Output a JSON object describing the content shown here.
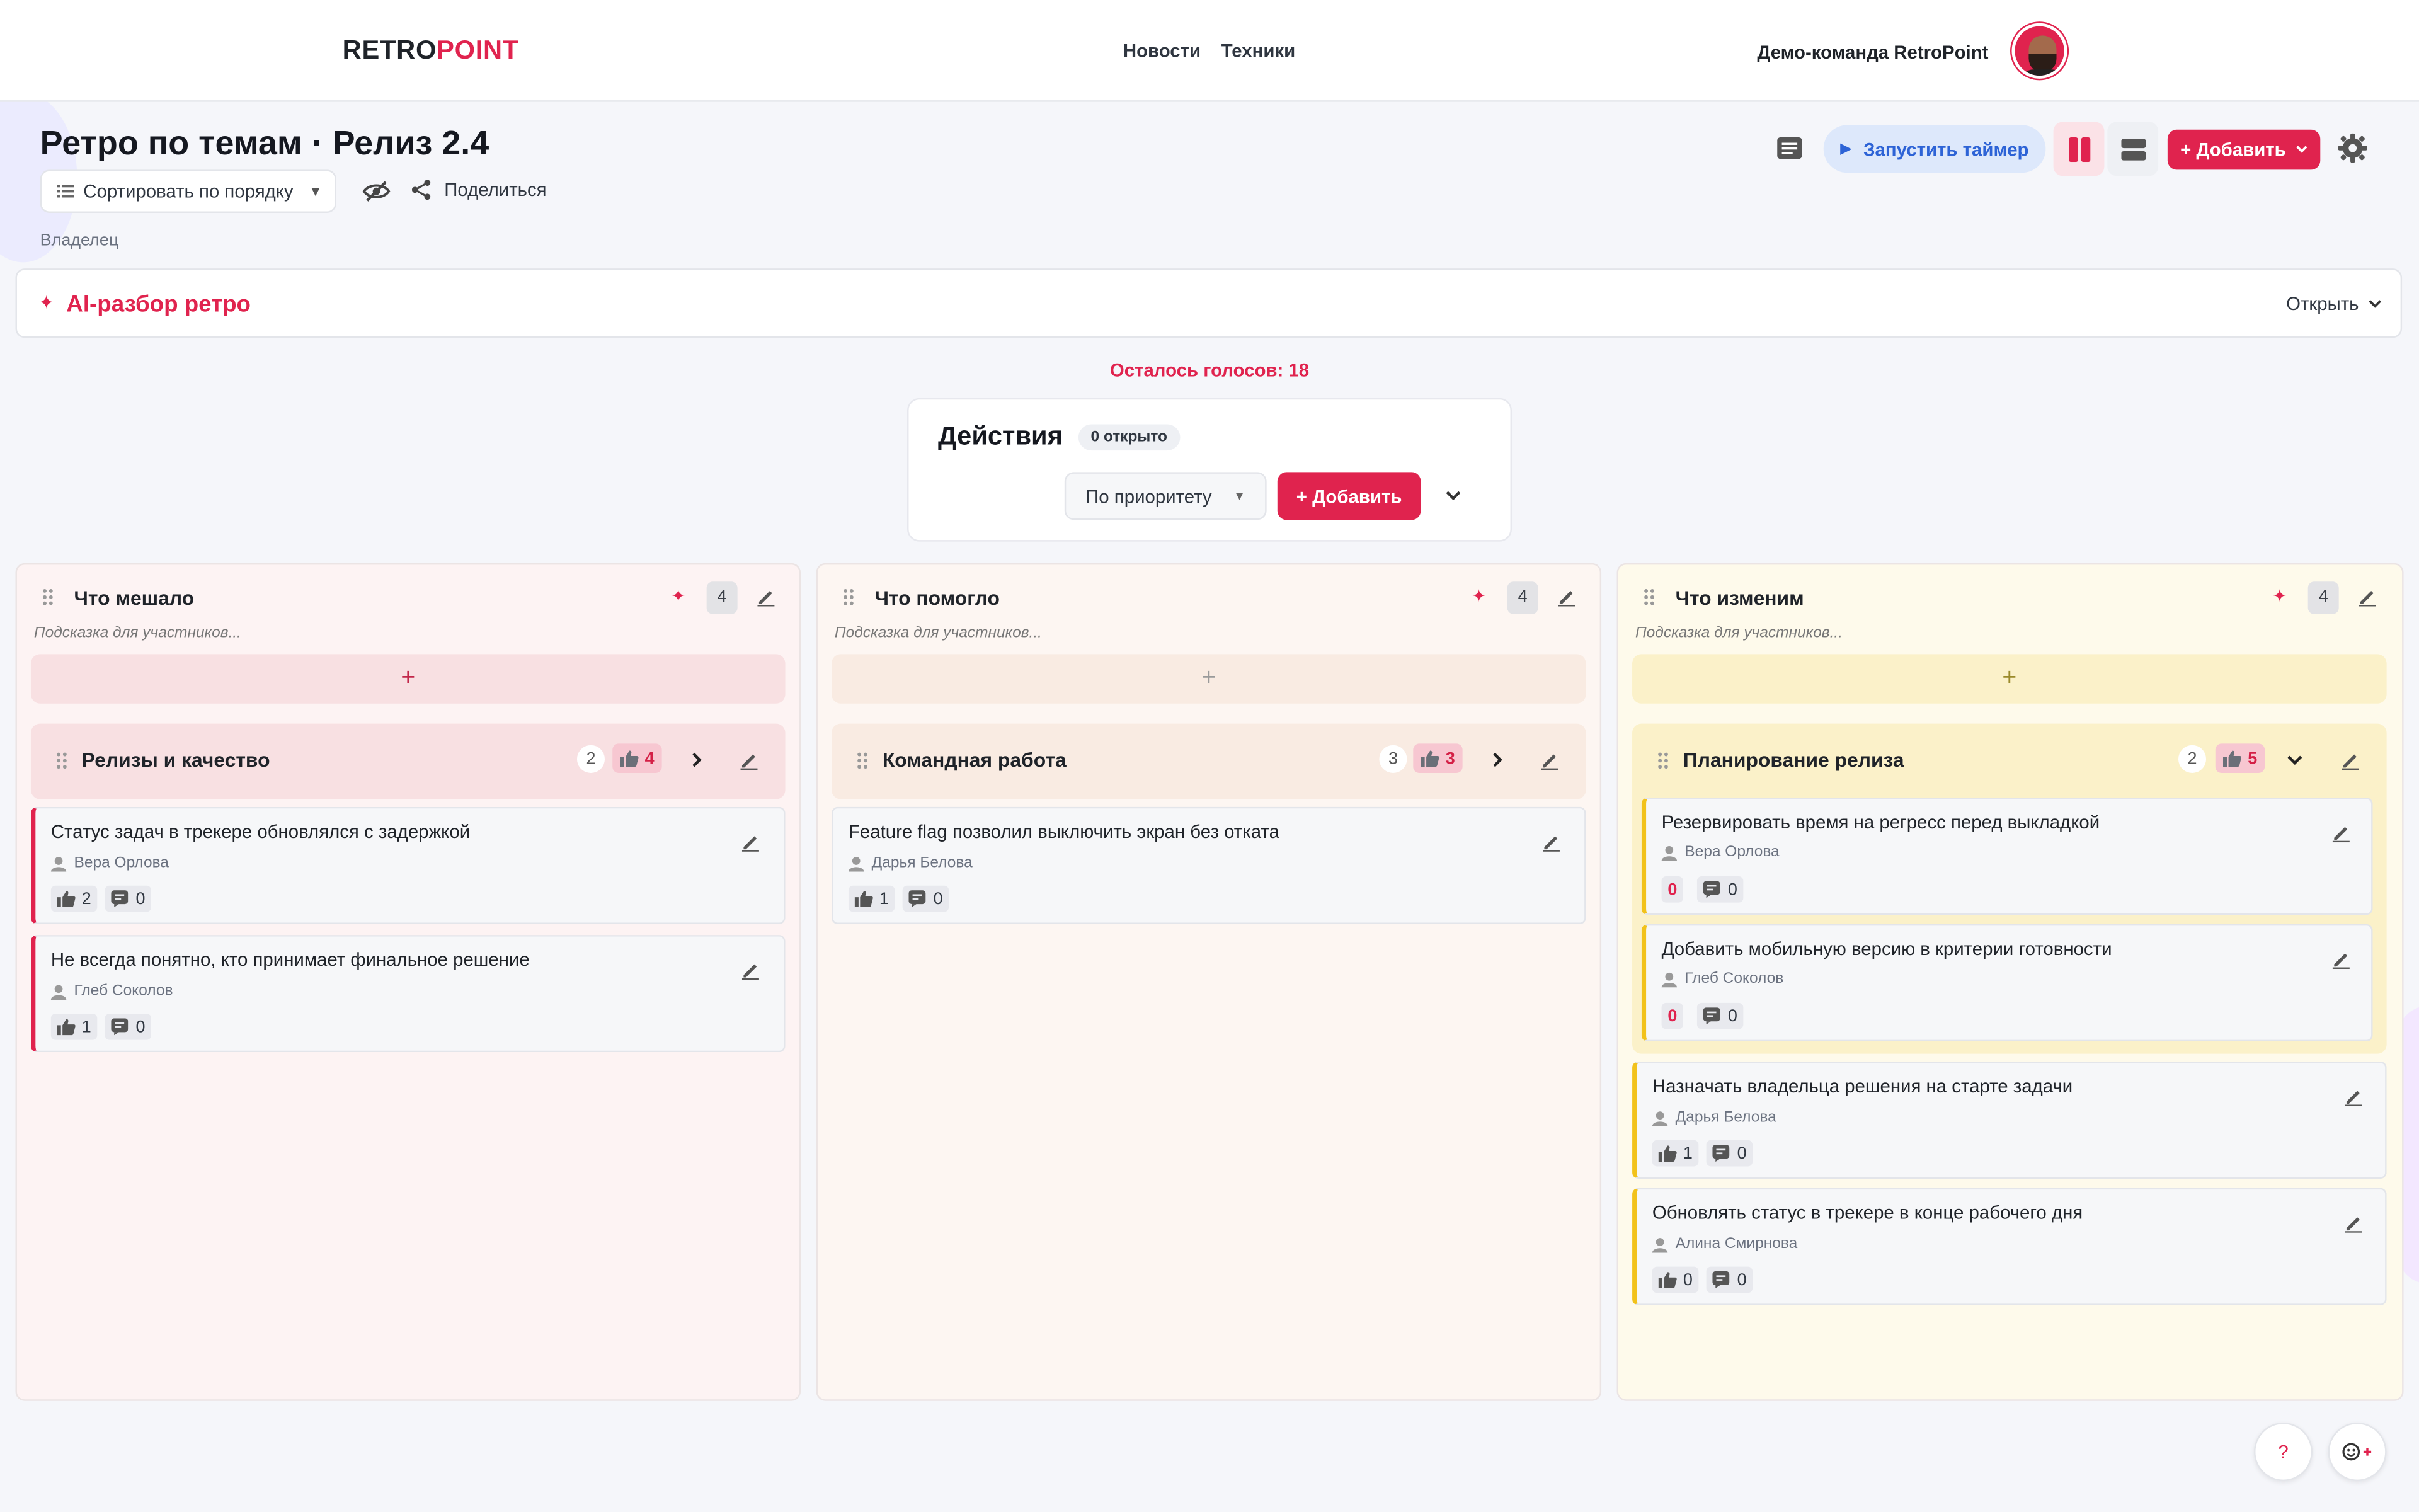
{
  "header": {
    "logo_part1": "RETRO",
    "logo_part2": "POINT",
    "nav": [
      "Новости",
      "Техники"
    ],
    "team_name": "Демо-команда RetroPoint"
  },
  "board": {
    "title": "Ретро по темам · Релиз 2.4",
    "sort_label": "Сортировать по порядку",
    "share_label": "Поделиться",
    "owner_label": "Владелец",
    "timer_label": "Запустить таймер",
    "add_label": "+ Добавить"
  },
  "ai": {
    "title": "AI-разбор ретро",
    "open_label": "Открыть"
  },
  "votes_left": "Осталось голосов: 18",
  "actions": {
    "title": "Действия",
    "badge": "0 открыто",
    "sort": "По приоритету",
    "add": "+ Добавить"
  },
  "columns": [
    {
      "title": "Что мешало",
      "count": "4",
      "hint": "Подсказка для участников...",
      "accent": "#e0234e",
      "group": {
        "title": "Релизы и качество",
        "count": "2",
        "votes": "4"
      },
      "cards": [
        {
          "text": "Статус задач в трекере обновлялся с задержкой",
          "author": "Вера Орлова",
          "likes": "2",
          "comments": "0"
        },
        {
          "text": "Не всегда понятно, кто принимает финальное решение",
          "author": "Глеб Соколов",
          "likes": "1",
          "comments": "0"
        }
      ]
    },
    {
      "title": "Что помогло",
      "count": "4",
      "hint": "Подсказка для участников...",
      "accent": "#c8c8c8",
      "group": {
        "title": "Командная работа",
        "count": "3",
        "votes": "3"
      },
      "cards": [
        {
          "text": "Feature flag позволил выключить экран без отката",
          "author": "Дарья Белова",
          "likes": "1",
          "comments": "0"
        }
      ]
    },
    {
      "title": "Что изменим",
      "count": "4",
      "hint": "Подсказка для участников...",
      "accent": "#f2c21b",
      "group": {
        "title": "Планирование релиза",
        "count": "2",
        "votes": "5"
      },
      "group_cards": [
        {
          "text": "Резервировать время на регресс перед выкладкой",
          "author": "Вера Орлова",
          "likes": "0",
          "comments": "0"
        },
        {
          "text": "Добавить мобильную версию в критерии готовности",
          "author": "Глеб Соколов",
          "likes": "0",
          "comments": "0"
        }
      ],
      "cards": [
        {
          "text": "Назначать владельца решения на старте задачи",
          "author": "Дарья Белова",
          "likes": "1",
          "comments": "0"
        },
        {
          "text": "Обновлять статус в трекере в конце рабочего дня",
          "author": "Алина Смирнова",
          "likes": "0",
          "comments": "0"
        }
      ]
    }
  ],
  "fab": {
    "help": "?"
  }
}
